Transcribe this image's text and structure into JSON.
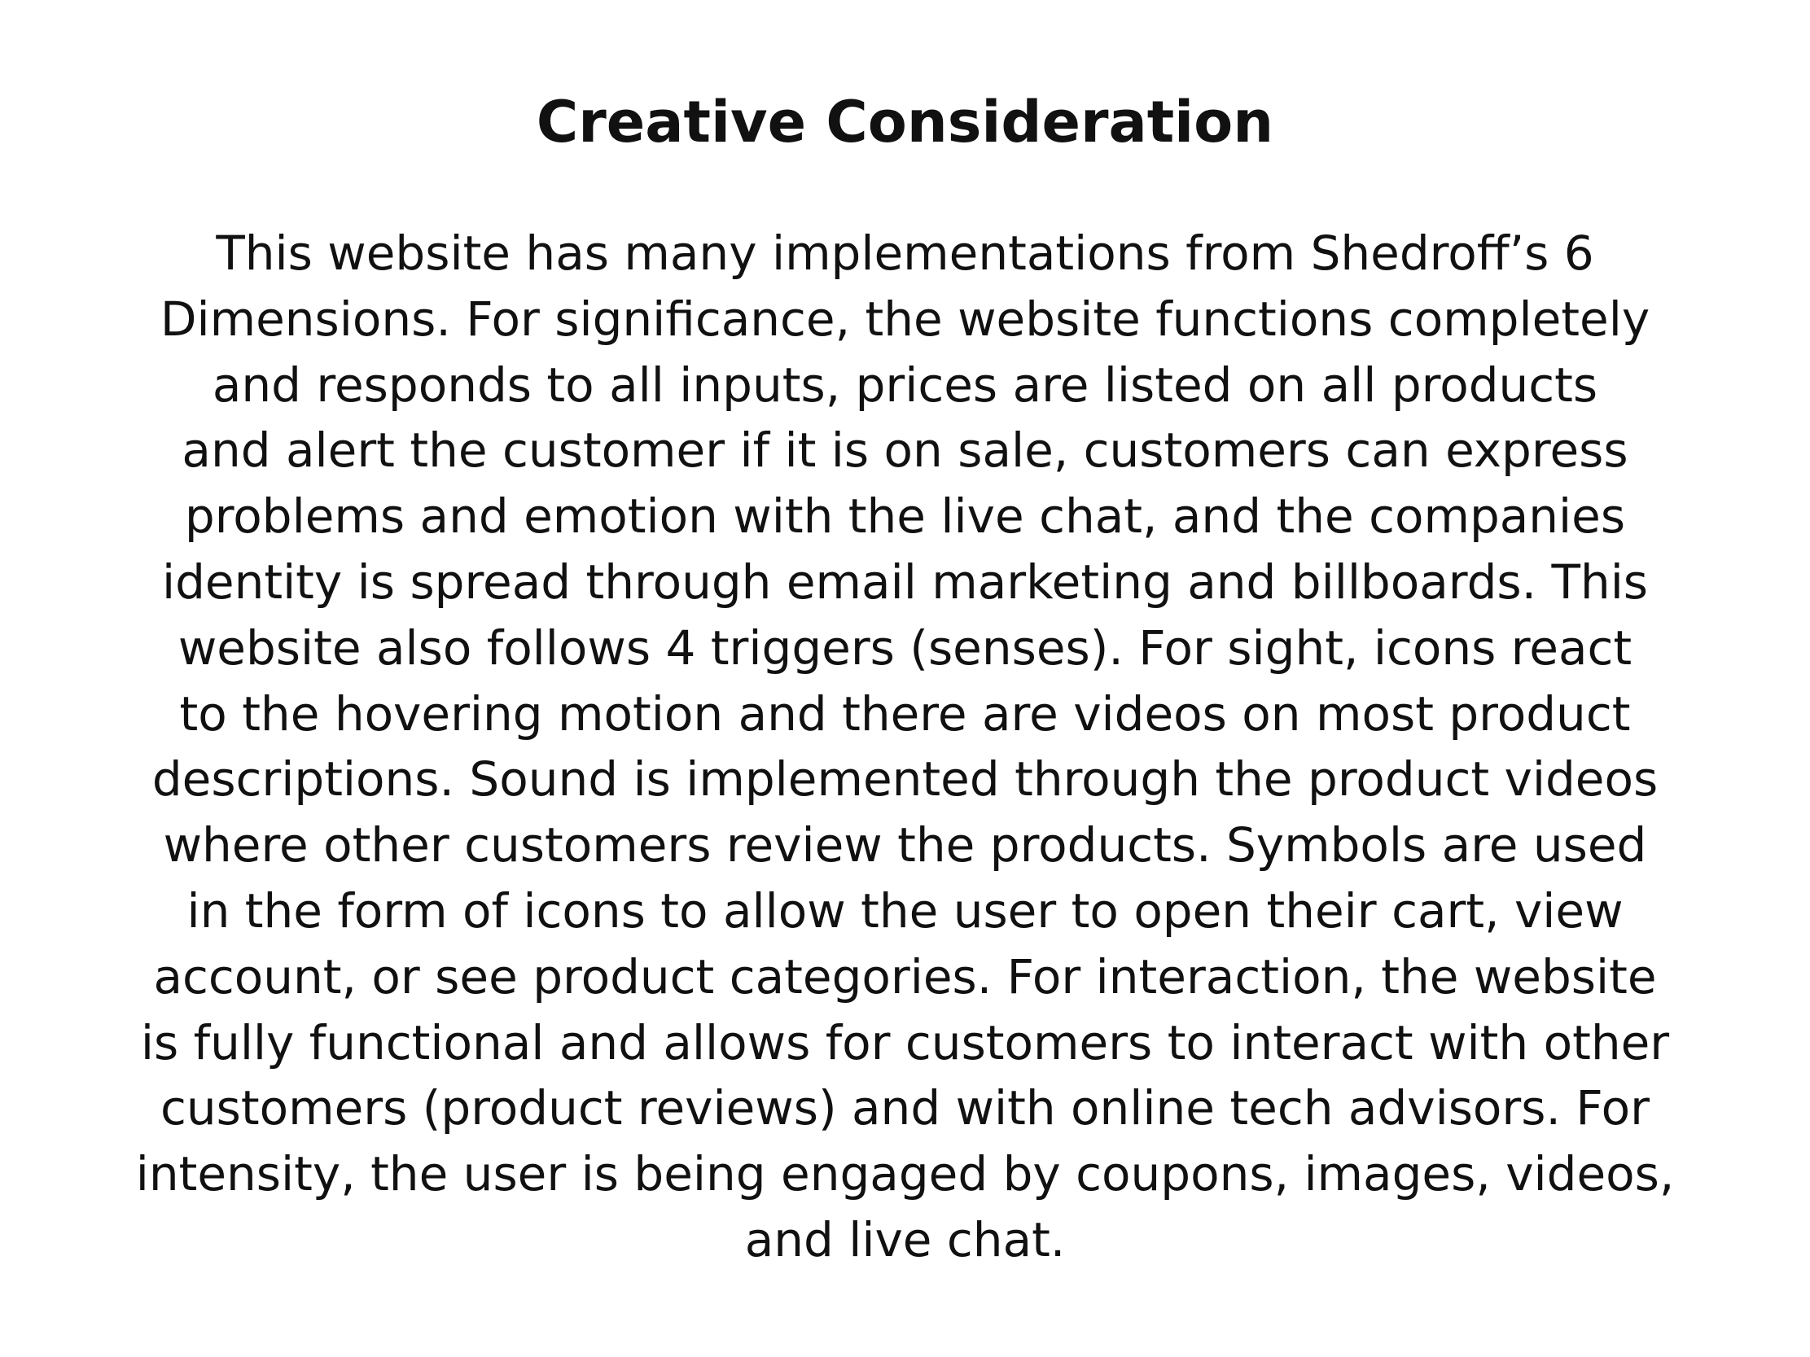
{
  "title": "Creative Consideration",
  "body_lines": [
    "This website has many implementations from Shedroff’s 6",
    "Dimensions. For significance, the website functions completely",
    "and responds to all inputs, prices are listed on all products",
    "and alert the customer if it is on sale, customers can express",
    "problems and emotion with the live chat, and the companies",
    "identity is spread through email marketing and billboards. This",
    "website also follows 4 triggers (senses). For sight, icons react",
    "to the hovering motion and there are videos on most product",
    "descriptions. Sound is implemented through the product videos",
    "where other customers review the products. Symbols are used",
    "in the form of icons to allow the user to open their cart, view",
    "account, or see product categories. For interaction, the website",
    "is fully functional and allows for customers to interact with other",
    "customers (product reviews) and with online tech advisors. For",
    "intensity, the user is being engaged by coupons, images, videos,",
    "and live chat."
  ]
}
